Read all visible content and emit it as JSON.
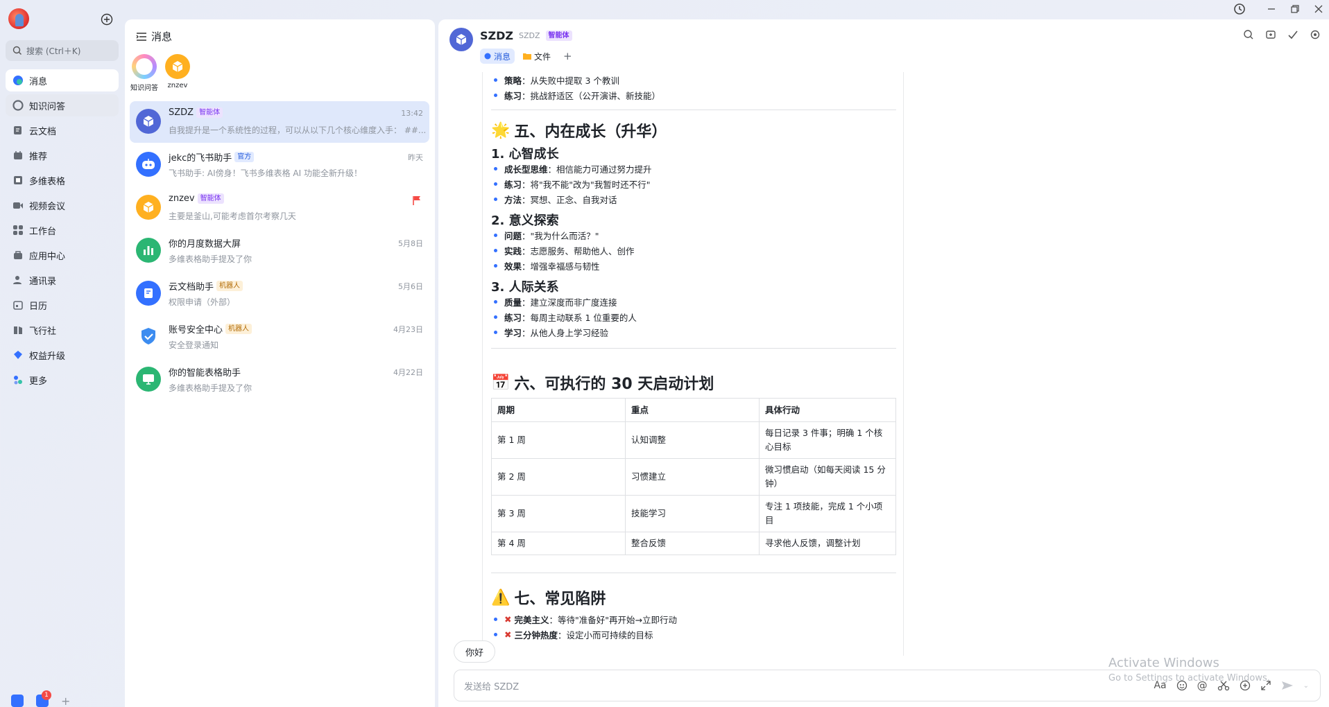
{
  "window": {
    "controls": [
      "history-icon",
      "minimize-icon",
      "restore-icon",
      "close-icon"
    ]
  },
  "nav": {
    "search_placeholder": "搜索 (Ctrl＋K)",
    "items": [
      {
        "label": "消息",
        "icon": "message-icon"
      },
      {
        "label": "知识问答",
        "icon": "knowledge-icon"
      },
      {
        "label": "云文档",
        "icon": "cloud-doc-icon"
      },
      {
        "label": "推荐",
        "icon": "recommend-icon"
      },
      {
        "label": "多维表格",
        "icon": "base-table-icon"
      },
      {
        "label": "视频会议",
        "icon": "video-meeting-icon"
      },
      {
        "label": "工作台",
        "icon": "workplace-icon"
      },
      {
        "label": "应用中心",
        "icon": "app-center-icon"
      },
      {
        "label": "通讯录",
        "icon": "contacts-icon"
      },
      {
        "label": "日历",
        "icon": "calendar-icon"
      },
      {
        "label": "飞行社",
        "icon": "community-icon"
      },
      {
        "label": "权益升级",
        "icon": "upgrade-icon"
      },
      {
        "label": "更多",
        "icon": "more-icon"
      }
    ],
    "bottom_badge": "1"
  },
  "list": {
    "title": "消息",
    "pinned": [
      {
        "label": "知识问答"
      },
      {
        "label": "znzev"
      }
    ],
    "conversations": [
      {
        "name": "SZDZ",
        "tag": "智能体",
        "preview": "自我提升是一个系统性的过程，可以从以下几个核心维度入手：  ##...",
        "time": "13:42"
      },
      {
        "name": "jekc的飞书助手",
        "tag": "官方",
        "preview": "飞书助手: AI傍身！飞书多维表格 AI 功能全新升级！",
        "time": "昨天"
      },
      {
        "name": "znzev",
        "tag": "智能体",
        "preview": "主要是釜山,可能考虑首尔考察几天",
        "time": ""
      },
      {
        "name": "你的月度数据大屏",
        "tag": "",
        "preview": "多维表格助手提及了你",
        "time": "5月8日"
      },
      {
        "name": "云文档助手",
        "tag": "机器人",
        "preview": "权限申请（外部）",
        "time": "5月6日"
      },
      {
        "name": "账号安全中心",
        "tag": "机器人",
        "preview": "安全登录通知",
        "time": "4月23日"
      },
      {
        "name": "你的智能表格助手",
        "tag": "",
        "preview": "多维表格助手提及了你",
        "time": "4月22日"
      }
    ]
  },
  "chat": {
    "title": "SZDZ",
    "subtitle": "SZDZ",
    "tag": "智能体",
    "tabs": [
      "消息",
      "文件"
    ],
    "doc": {
      "top_bullets": [
        {
          "k": "策略",
          "v": "：从失败中提取 3 个教训"
        },
        {
          "k": "练习",
          "v": "：挑战舒适区（公开演讲、新技能）"
        }
      ],
      "sec5": {
        "emoji": "🌟",
        "title": "五、内在成长（升华）",
        "subs": [
          {
            "title": "1. 心智成长",
            "items": [
              {
                "k": "成长型思维",
                "v": "：相信能力可通过努力提升"
              },
              {
                "k": "练习",
                "v": "：将\"我不能\"改为\"我暂时还不行\""
              },
              {
                "k": "方法",
                "v": "：冥想、正念、自我对话"
              }
            ]
          },
          {
            "title": "2. 意义探索",
            "items": [
              {
                "k": "问题",
                "v": "：\"我为什么而活？\""
              },
              {
                "k": "实践",
                "v": "：志愿服务、帮助他人、创作"
              },
              {
                "k": "效果",
                "v": "：增强幸福感与韧性"
              }
            ]
          },
          {
            "title": "3. 人际关系",
            "items": [
              {
                "k": "质量",
                "v": "：建立深度而非广度连接"
              },
              {
                "k": "练习",
                "v": "：每周主动联系 1 位重要的人"
              },
              {
                "k": "学习",
                "v": "：从他人身上学习经验"
              }
            ]
          }
        ]
      },
      "sec6": {
        "emoji": "📅",
        "title": "六、可执行的 30 天启动计划",
        "headers": [
          "周期",
          "重点",
          "具体行动"
        ],
        "rows": [
          [
            "第 1 周",
            "认知调整",
            "每日记录 3 件事；明确 1 个核心目标"
          ],
          [
            "第 2 周",
            "习惯建立",
            "微习惯启动（如每天阅读 15 分钟）"
          ],
          [
            "第 3 周",
            "技能学习",
            "专注 1 项技能，完成 1 个小项目"
          ],
          [
            "第 4 周",
            "整合反馈",
            "寻求他人反馈，调整计划"
          ]
        ]
      },
      "sec7": {
        "emoji": "⚠️",
        "title": "七、常见陷阱",
        "items": [
          {
            "k": "完美主义",
            "v": "：等待\"准备好\"再开始→立即行动"
          },
          {
            "k": "三分钟热度",
            "v": "：设定小而可持续的目标"
          }
        ]
      }
    },
    "quick_reply": "你好",
    "input_placeholder": "发送给 SZDZ"
  },
  "watermark": {
    "line1": "Activate Windows",
    "line2": "Go to Settings to activate Windows."
  }
}
